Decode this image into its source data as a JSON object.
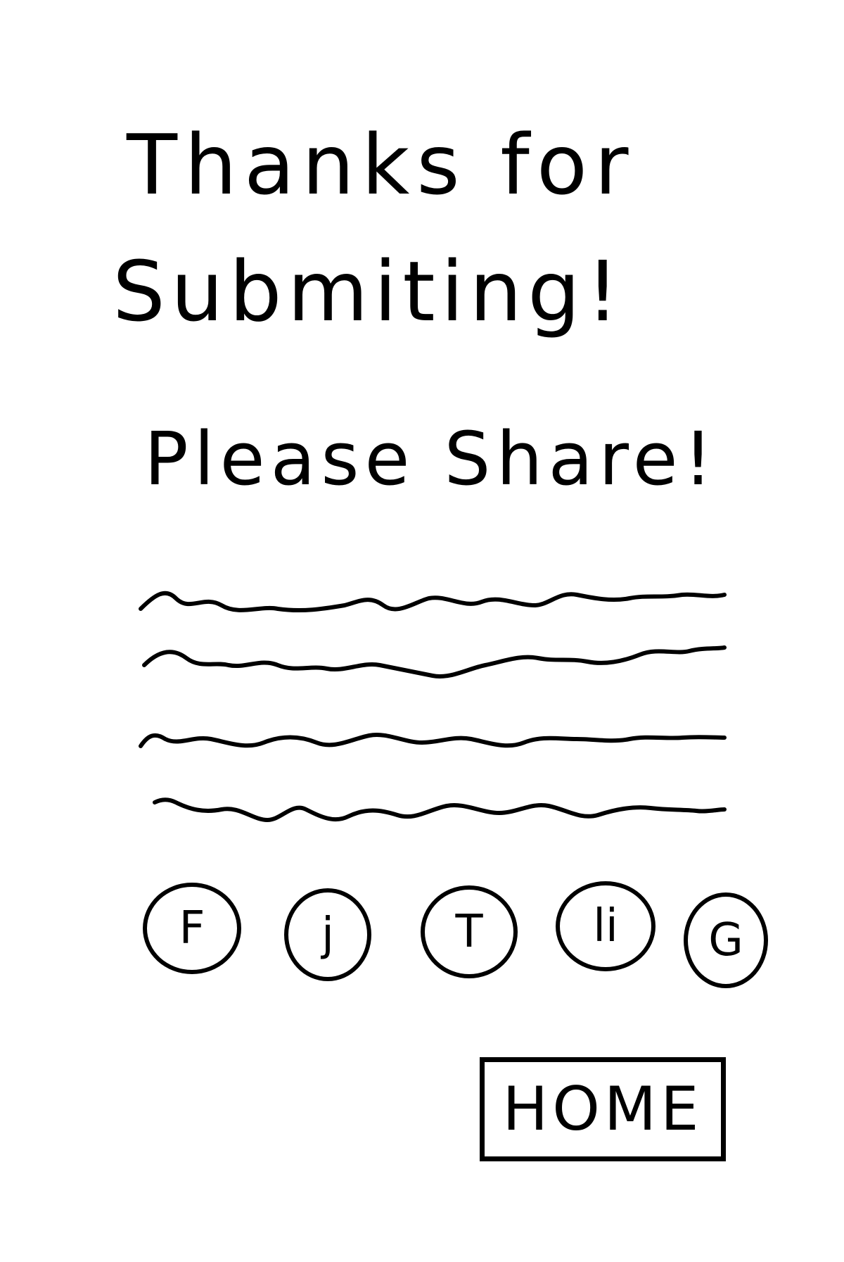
{
  "confirmation": {
    "title_line_1": "Thanks for",
    "title_line_2": "Submiting!",
    "subtitle": "Please Share!"
  },
  "share": {
    "buttons": [
      {
        "label": "F",
        "icon": "facebook-icon"
      },
      {
        "label": "j",
        "icon": "share-icon"
      },
      {
        "label": "T",
        "icon": "twitter-icon"
      },
      {
        "label": "li",
        "icon": "linkedin-icon"
      },
      {
        "label": "G",
        "icon": "google-icon"
      }
    ]
  },
  "nav": {
    "home_label": "HOME"
  }
}
